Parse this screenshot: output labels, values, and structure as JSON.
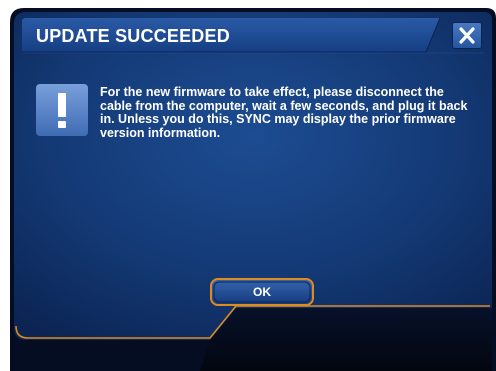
{
  "dialog": {
    "title": "UPDATE SUCCEEDED",
    "message": "For the new firmware to take effect, please disconnect the cable from the computer, wait a few seconds, and plug it back in. Unless you do this, SYNC may display the prior firmware version information.",
    "ok_label": "OK",
    "icon": "exclamation-icon",
    "close_icon": "close-icon"
  },
  "colors": {
    "panel_dark": "#0a1a3f",
    "panel_mid": "#163a7a",
    "title_bar": "#1f4b94",
    "accent_orange": "#e08a1e",
    "icon_blue": "#5d86c6"
  }
}
